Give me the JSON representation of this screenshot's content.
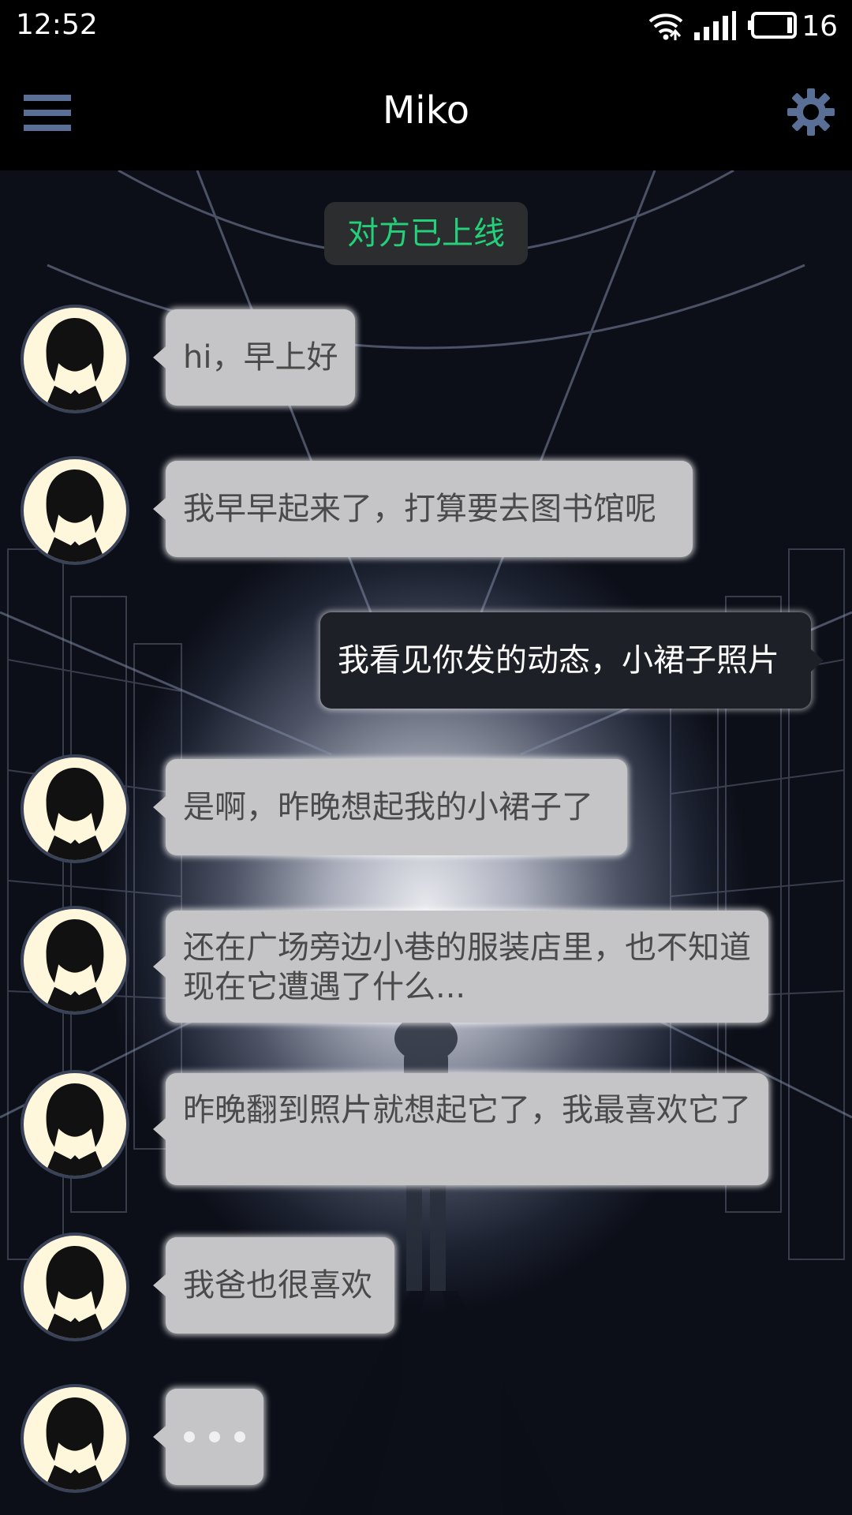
{
  "status_bar": {
    "time": "12:52",
    "battery_level": "16"
  },
  "header": {
    "title": "Miko"
  },
  "system_notice": "对方已上线",
  "messages": [
    {
      "sender": "Miko",
      "text": "hi，早上好"
    },
    {
      "sender": "Miko",
      "text": "我早早起来了，打算要去图书馆呢"
    },
    {
      "sender": "me",
      "text": "我看见你发的动态，小裙子照片"
    },
    {
      "sender": "Miko",
      "text": "是啊，昨晚想起我的小裙子了"
    },
    {
      "sender": "Miko",
      "text": "还在广场旁边小巷的服装店里，也不知道现在它遭遇了什么..."
    },
    {
      "sender": "Miko",
      "text": "昨晚翻到照片就想起它了，我最喜欢它了"
    },
    {
      "sender": "Miko",
      "text": "我爸也很喜欢"
    },
    {
      "sender": "Miko",
      "typing": true
    }
  ],
  "icons": {
    "menu": "hamburger-menu-icon",
    "settings": "gear-icon",
    "wifi": "wifi-icon",
    "signal": "signal-icon",
    "battery": "battery-icon",
    "avatar": "avatar-silhouette"
  },
  "colors": {
    "online_text": "#24d07a",
    "incoming_bubble": "#c5c5c7",
    "outgoing_bubble": "#1d2026",
    "nav_icon": "#5a6f96"
  }
}
